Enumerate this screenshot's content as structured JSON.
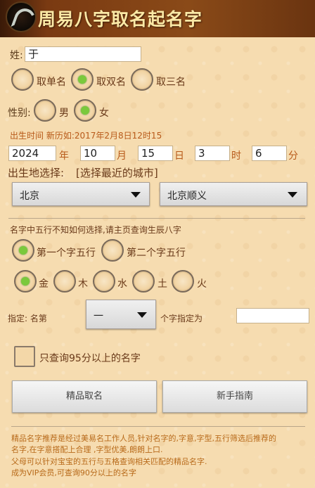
{
  "app": {
    "title": "周易八字取名起名字"
  },
  "surname": {
    "label": "姓:",
    "value": "于"
  },
  "name_length": {
    "options": [
      {
        "label": "取单名",
        "checked": false
      },
      {
        "label": "取双名",
        "checked": true
      },
      {
        "label": "取三名",
        "checked": false
      }
    ]
  },
  "gender": {
    "label": "性别:",
    "options": [
      {
        "label": "男",
        "checked": false
      },
      {
        "label": "女",
        "checked": true
      }
    ]
  },
  "birth": {
    "hint": "出生时间 新历如:2017年2月8日12时15",
    "year": "2024",
    "year_unit": "年",
    "month": "10",
    "month_unit": "月",
    "day": "15",
    "day_unit": "日",
    "hour": "3",
    "hour_unit": "时",
    "minute": "6",
    "minute_unit": "分"
  },
  "birthplace": {
    "label": "出生地选择:",
    "hint": "[选择最近的城市]",
    "province": "北京",
    "city": "北京顺义"
  },
  "wuxing": {
    "hint": "名字中五行不知如何选择,请主页查询生辰八字",
    "position_options": [
      {
        "label": "第一个字五行",
        "checked": true
      },
      {
        "label": "第二个字五行",
        "checked": false
      }
    ],
    "element_options": [
      {
        "label": "金",
        "checked": true
      },
      {
        "label": "木",
        "checked": false
      },
      {
        "label": "水",
        "checked": false
      },
      {
        "label": "土",
        "checked": false
      },
      {
        "label": "火",
        "checked": false
      }
    ]
  },
  "designate": {
    "prefix": "指定: 名第",
    "position_value": "一",
    "suffix": "个字指定为",
    "value": ""
  },
  "filter": {
    "label": "只查询95分以上的名字",
    "checked": false
  },
  "buttons": {
    "premium": "精品取名",
    "guide": "新手指南"
  },
  "footer": {
    "lines": [
      "精品名字推荐是经过美易名工作人员,针对名字的,字意,字型,五行筛选后推荐的",
      "名字,在字意搭配上合理 ,字型优美,朗朗上口.",
      "父母可以针对宝宝的五行与五格查询相关匹配的精品名字.",
      "成为VIP会员,可查询90分以上的名字"
    ]
  }
}
